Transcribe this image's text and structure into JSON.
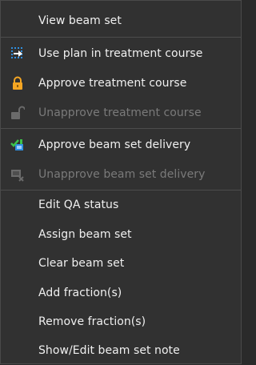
{
  "menu": {
    "items": [
      {
        "label": "View beam set",
        "icon": null,
        "enabled": true
      },
      {
        "label": "Use plan in treatment course",
        "icon": "use-plan-icon",
        "enabled": true
      },
      {
        "label": "Approve treatment course",
        "icon": "lock-icon",
        "enabled": true
      },
      {
        "label": "Unapprove treatment course",
        "icon": "unlock-icon",
        "enabled": false
      },
      {
        "label": "Approve beam set delivery",
        "icon": "approve-delivery-icon",
        "enabled": true
      },
      {
        "label": "Unapprove beam set delivery",
        "icon": "unapprove-delivery-icon",
        "enabled": false
      },
      {
        "label": "Edit QA status",
        "icon": null,
        "enabled": true
      },
      {
        "label": "Assign beam set",
        "icon": null,
        "enabled": true
      },
      {
        "label": "Clear beam set",
        "icon": null,
        "enabled": true
      },
      {
        "label": "Add fraction(s)",
        "icon": null,
        "enabled": true
      },
      {
        "label": "Remove fraction(s)",
        "icon": null,
        "enabled": true
      },
      {
        "label": "Show/Edit beam set note",
        "icon": null,
        "enabled": true
      }
    ]
  },
  "colors": {
    "background": "#313131",
    "text": "#f0f0f0",
    "disabled_text": "#7a7a7a",
    "lock_orange": "#f5a623",
    "use_plan_blue": "#2f8fe0",
    "approve_green": "#3cc24a"
  }
}
